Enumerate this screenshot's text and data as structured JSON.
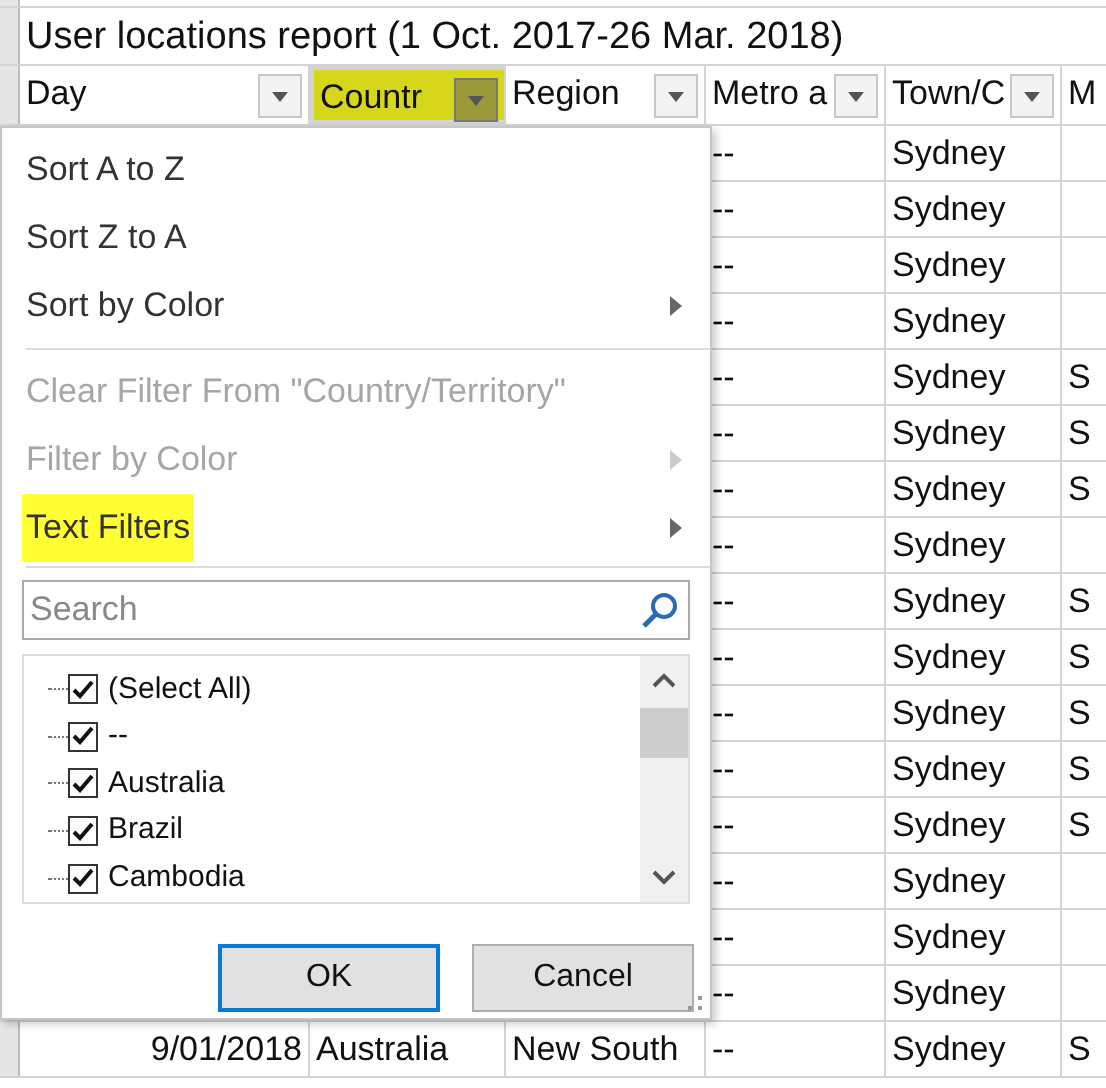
{
  "sheet": {
    "title": "User locations report (1 Oct. 2017-26 Mar. 2018)",
    "columns": [
      {
        "label": "Day",
        "filtered": false
      },
      {
        "label": "Countr",
        "filtered": true
      },
      {
        "label": "Region",
        "filtered": false
      },
      {
        "label": "Metro a",
        "filtered": false
      },
      {
        "label": "Town/C",
        "filtered": false
      },
      {
        "label": "M",
        "filtered": false
      }
    ],
    "rows": [
      {
        "metro": "--",
        "town": "Sydney"
      },
      {
        "metro": "--",
        "town": "Sydney"
      },
      {
        "metro": "--",
        "town": "Sydney"
      },
      {
        "metro": "--",
        "town": "Sydney"
      },
      {
        "metro": "--",
        "town": "Sydney",
        "column_6": "S"
      },
      {
        "metro": "--",
        "town": "Sydney",
        "column_6": "S"
      },
      {
        "metro": "--",
        "town": "Sydney",
        "column_6": "S"
      },
      {
        "metro": "--",
        "town": "Sydney"
      },
      {
        "metro": "--",
        "town": "Sydney",
        "column_6": "S"
      },
      {
        "metro": "--",
        "town": "Sydney",
        "column_6": "S"
      },
      {
        "metro": "--",
        "town": "Sydney",
        "column_6": "S"
      },
      {
        "metro": "--",
        "town": "Sydney",
        "column_6": "S"
      },
      {
        "metro": "--",
        "town": "Sydney",
        "column_6": "S"
      },
      {
        "metro": "--",
        "town": "Sydney"
      },
      {
        "metro": "--",
        "town": "Sydney"
      },
      {
        "metro": "--",
        "town": "Sydney"
      },
      {
        "day": "9/01/2018",
        "country": "Australia",
        "region": "New South",
        "metro": "--",
        "town": "Sydney",
        "column_6": "S"
      }
    ]
  },
  "filter_menu": {
    "items": [
      {
        "kind": "command",
        "label": "Sort A to Z",
        "disabled": false,
        "submenu": false,
        "highlighted": false
      },
      {
        "kind": "command",
        "label": "Sort Z to A",
        "disabled": false,
        "submenu": false,
        "highlighted": false
      },
      {
        "kind": "command",
        "label": "Sort by Color",
        "disabled": false,
        "submenu": true,
        "highlighted": false
      },
      {
        "kind": "separator"
      },
      {
        "kind": "command",
        "label": "Clear Filter From \"Country/Territory\"",
        "disabled": true,
        "submenu": false,
        "highlighted": false
      },
      {
        "kind": "command",
        "label": "Filter by Color",
        "disabled": true,
        "submenu": true,
        "highlighted": false
      },
      {
        "kind": "command",
        "label": "Text Filters",
        "disabled": false,
        "submenu": true,
        "highlighted": true
      }
    ],
    "search": {
      "placeholder": "Search"
    },
    "values": [
      {
        "label": "(Select All)",
        "checked": true
      },
      {
        "label": "--",
        "checked": true
      },
      {
        "label": "Australia",
        "checked": true
      },
      {
        "label": "Brazil",
        "checked": true
      },
      {
        "label": "Cambodia",
        "checked": true
      }
    ],
    "buttons": [
      {
        "label": "OK",
        "default": true
      },
      {
        "label": "Cancel",
        "default": false
      }
    ]
  }
}
